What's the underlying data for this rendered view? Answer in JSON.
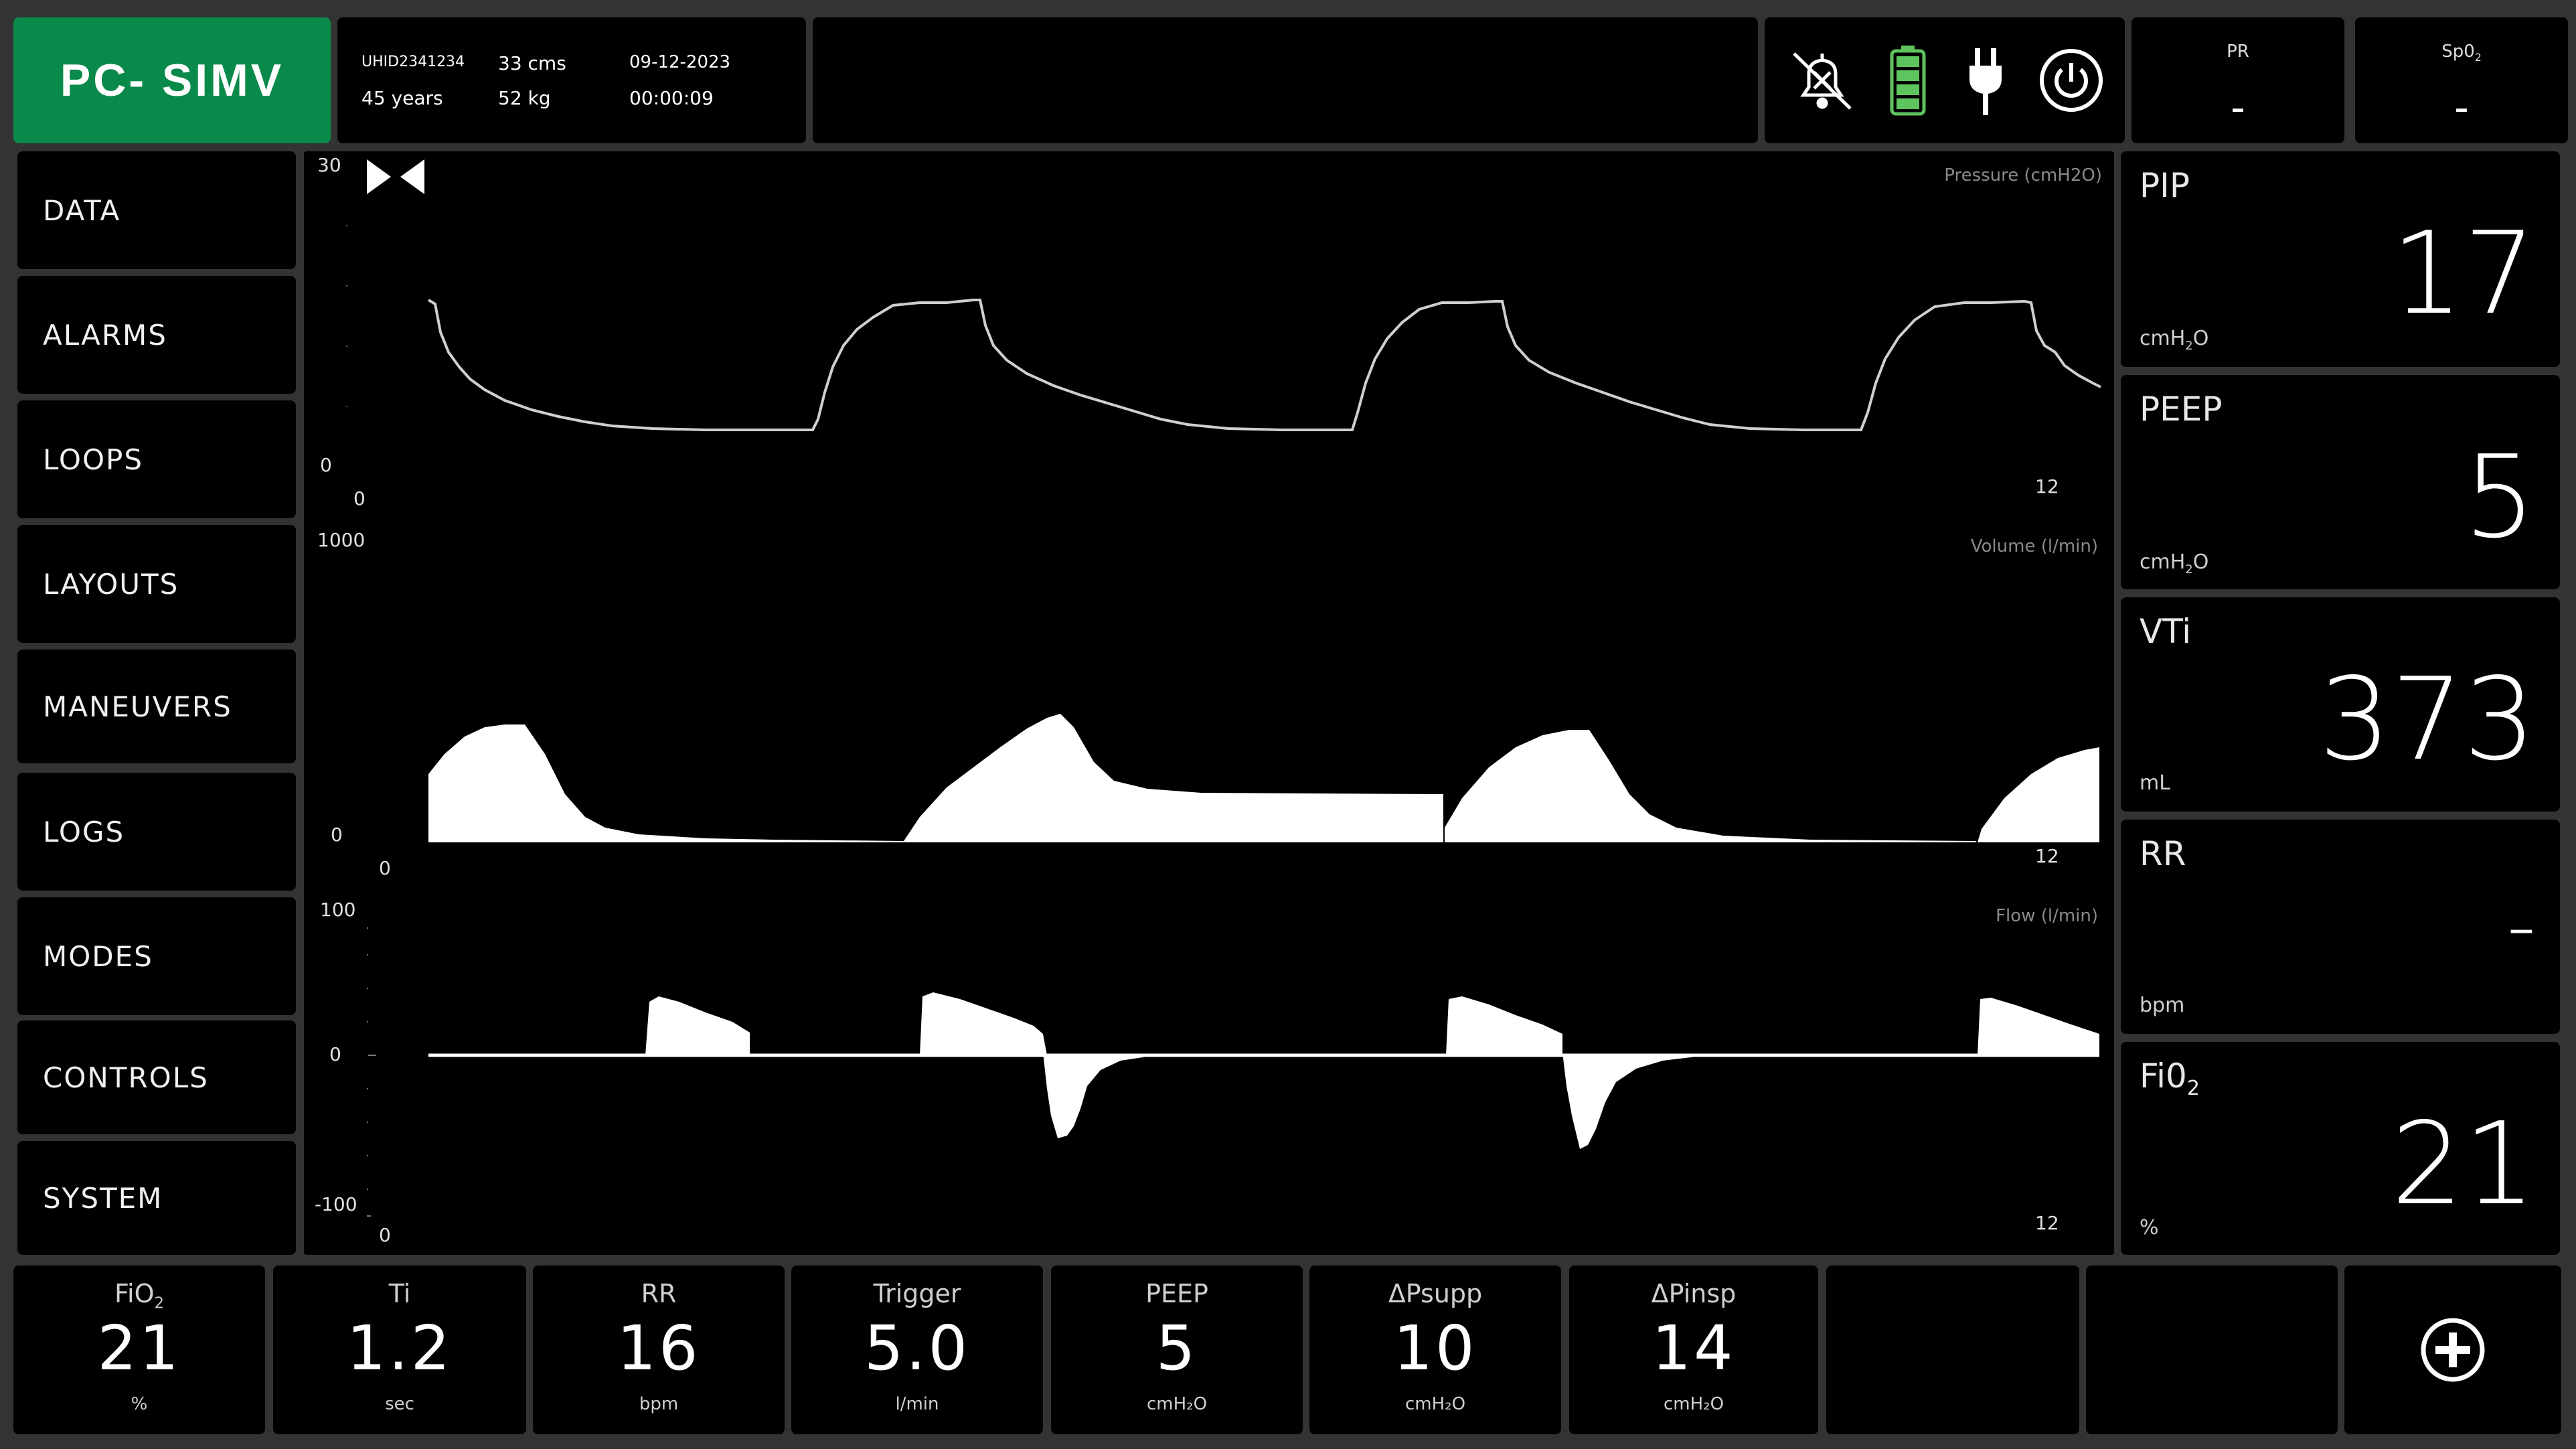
{
  "header": {
    "mode": "PC- SIMV",
    "patient": {
      "uhid": "UHID2341234",
      "age": "45 years",
      "height": "33 cms",
      "weight": "52 kg",
      "date": "09-12-2023",
      "elapsed": "00:00:09"
    },
    "icons": [
      "alarm-silenced-icon",
      "battery-icon",
      "plug-icon",
      "power-icon"
    ],
    "pr": {
      "label": "PR",
      "value": "-"
    },
    "spo2": {
      "label": "Sp0",
      "sub": "2",
      "value": "-"
    }
  },
  "nav": [
    "DATA",
    "ALARMS",
    "LOOPS",
    "LAYOUTS",
    "MANEUVERS",
    "LOGS",
    "MODES",
    "CONTROLS",
    "SYSTEM"
  ],
  "waveforms": {
    "pressure": {
      "title": "Pressure (cmH2O)",
      "ymax": "30",
      "ymin": "0",
      "xmin": "0",
      "xmax": "12"
    },
    "volume": {
      "title": "Volume (l/min)",
      "ymax": "1000",
      "ymin": "0",
      "xmin": "0",
      "xmax": "12"
    },
    "flow": {
      "title": "Flow (l/min)",
      "ymax": "100",
      "ymid": "0",
      "ymin": "-100",
      "xmin": "0",
      "xmax": "12"
    }
  },
  "vitals": {
    "pip": {
      "label": "PIP",
      "value": "17",
      "unit_main": "cmH",
      "unit_sub": "2",
      "unit_end": "O"
    },
    "peep": {
      "label": "PEEP",
      "value": "5",
      "unit_main": "cmH",
      "unit_sub": "2",
      "unit_end": "O"
    },
    "vti": {
      "label": "VTi",
      "value": "373",
      "unit": "mL"
    },
    "rr": {
      "label": "RR",
      "value": "-",
      "unit": "bpm"
    },
    "fio2": {
      "label": "Fi0",
      "label_sub": "2",
      "value": "21",
      "unit": "%"
    }
  },
  "controls": [
    {
      "label": "FiO",
      "label_sub": "2",
      "value": "21",
      "unit": "%"
    },
    {
      "label": "Ti",
      "label_sub": "",
      "value": "1.2",
      "unit": "sec"
    },
    {
      "label": "RR",
      "label_sub": "",
      "value": "16",
      "unit": "bpm"
    },
    {
      "label": "Trigger",
      "label_sub": "",
      "value": "5.0",
      "unit": "l/min"
    },
    {
      "label": "PEEP",
      "label_sub": "",
      "value": "5",
      "unit": "cmH₂O"
    },
    {
      "label": "ΔPsupp",
      "label_sub": "",
      "value": "10",
      "unit": "cmH₂O"
    },
    {
      "label": "ΔPinsp",
      "label_sub": "",
      "value": "14",
      "unit": "cmH₂O"
    }
  ],
  "colors": {
    "mode_bg": "#0a8a4a",
    "battery": "#5ec45e",
    "panel": "#000000",
    "frame": "#333333"
  }
}
